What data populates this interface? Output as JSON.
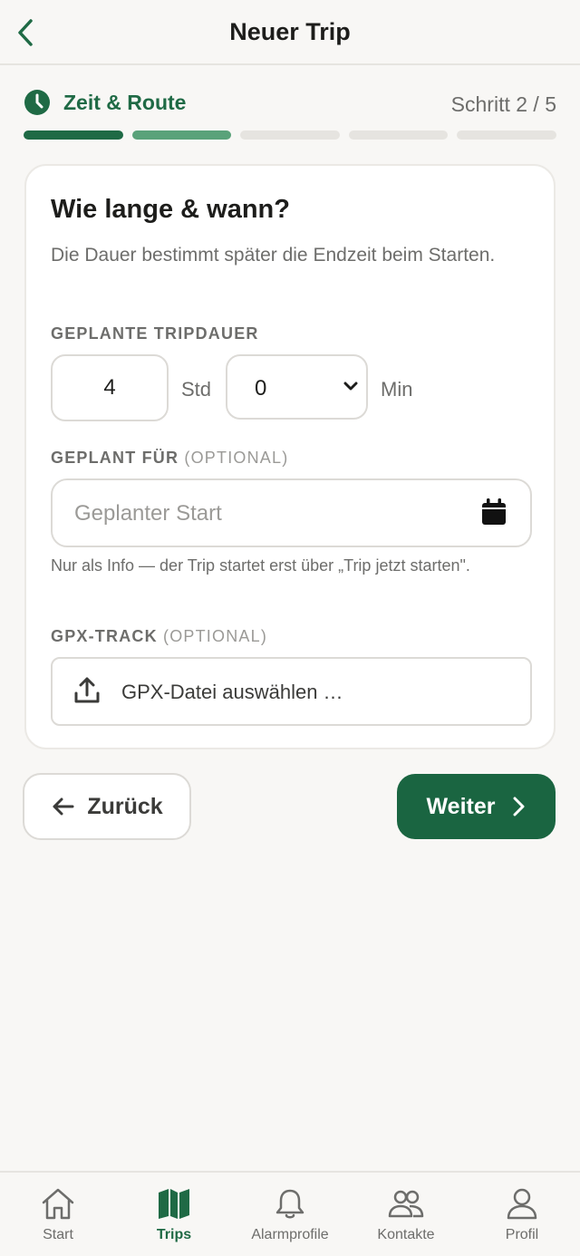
{
  "header": {
    "title": "Neuer Trip",
    "back_icon": "chevron-left-icon"
  },
  "step": {
    "label": "Zeit & Route",
    "counter": "Schritt 2 / 5",
    "current": 2,
    "total": 5,
    "icon": "clock-icon"
  },
  "card": {
    "title": "Wie lange & wann?",
    "subtitle": "Die Dauer bestimmt später die Endzeit beim Starten.",
    "duration": {
      "label": "GEPLANTE TRIPDAUER",
      "hours_value": "4",
      "hours_unit": "Std",
      "minutes_value": "0",
      "minutes_unit": "Min"
    },
    "planned": {
      "label": "GEPLANT FÜR",
      "optional": "(OPTIONAL)",
      "placeholder": "Geplanter Start",
      "hint": "Nur als Info — der Trip startet erst über „Trip jetzt starten\"."
    },
    "gpx": {
      "label": "GPX-TRACK",
      "optional": "(OPTIONAL)",
      "button": "GPX-Datei auswählen …"
    }
  },
  "actions": {
    "back": "Zurück",
    "next": "Weiter"
  },
  "tabbar": [
    {
      "label": "Start",
      "icon": "home-icon"
    },
    {
      "label": "Trips",
      "icon": "map-icon",
      "active": true
    },
    {
      "label": "Alarmprofile",
      "icon": "bell-icon"
    },
    {
      "label": "Kontakte",
      "icon": "users-icon"
    },
    {
      "label": "Profil",
      "icon": "user-icon"
    }
  ],
  "colors": {
    "accent": "#1f6a45",
    "accent_light": "#5aa27a",
    "button": "#1a6541",
    "background": "#f8f7f5"
  }
}
